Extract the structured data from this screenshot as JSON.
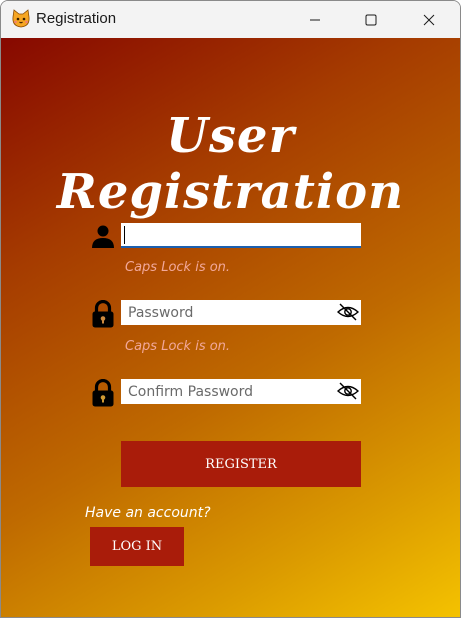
{
  "window": {
    "title": "Registration",
    "app_icon": "cat-face-icon",
    "controls": [
      "minimize-icon",
      "maximize-icon",
      "close-icon"
    ]
  },
  "heading": "User Registration",
  "username": {
    "value": "",
    "icon": "user-icon",
    "hint": "Caps Lock is on."
  },
  "password": {
    "placeholder": "Password",
    "icon": "lock-icon",
    "toggle_icon": "eye-slash-icon",
    "hint": "Caps Lock is on."
  },
  "confirm_password": {
    "placeholder": "Confirm Password",
    "icon": "lock-icon",
    "toggle_icon": "eye-slash-icon"
  },
  "register_button": "REGISTER",
  "have_account": "Have an account?",
  "login_button": "LOG IN",
  "colors": {
    "button": "#a91c0a",
    "hint": "#f2a89a",
    "gradient_start": "#870800",
    "gradient_end": "#f4c200",
    "focus_underline": "#1c5fae"
  }
}
